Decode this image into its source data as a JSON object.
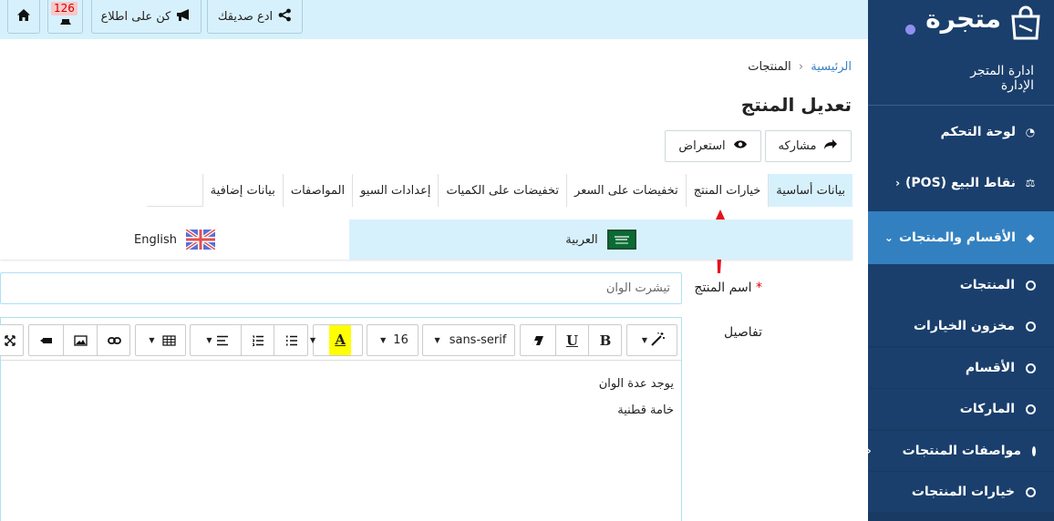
{
  "sidebar": {
    "logo_text": "متجرة",
    "store_title": "ادارة المتجر",
    "store_role": "الإدارة",
    "items": [
      {
        "label": "لوحة التحكم",
        "icon": "dashboard-icon"
      },
      {
        "label": "نقاط البيع (POS)",
        "icon": "scale-icon"
      },
      {
        "label": "الأقسام والمنتجات",
        "icon": "tag-icon"
      }
    ],
    "sub_items": [
      {
        "label": "المنتجات"
      },
      {
        "label": "مخزون الخيارات"
      },
      {
        "label": "الأقسام"
      },
      {
        "label": "الماركات"
      },
      {
        "label": "مواصفات المنتجات"
      },
      {
        "label": "خيارات المنتجات"
      }
    ]
  },
  "topbar": {
    "invite_label": "ادع صديقك",
    "notify_label": "كن على اطلاع",
    "notification_count": "126"
  },
  "breadcrumb": {
    "home": "الرئيسية",
    "current": "المنتجات"
  },
  "page_title": "تعديل المنتج",
  "actions": {
    "share": "مشاركه",
    "preview": "استعراض"
  },
  "tabs": [
    "بيانات أساسية",
    "خيارات المنتج",
    "تخفيضات على السعر",
    "تخفيضات على الكميات",
    "إعدادات السيو",
    "المواصفات",
    "بيانات إضافية"
  ],
  "languages": {
    "arabic": "العربية",
    "english": "English"
  },
  "form": {
    "name_label": "اسم المنتج",
    "required_mark": "*",
    "name_value": "تيشرت الوان",
    "details_label": "تفاصيل"
  },
  "editor": {
    "font_family": "sans-serif",
    "font_size": "16",
    "bold": "B",
    "underline": "U",
    "color_letter": "A",
    "content": [
      "يوجد عدة الوان",
      "خامة قطنية"
    ]
  },
  "colors": {
    "sidebar_bg": "#1a3f6c",
    "sidebar_active": "#3380c0",
    "topbar_bg": "#d7f1fc",
    "arrow": "#e8101c"
  }
}
